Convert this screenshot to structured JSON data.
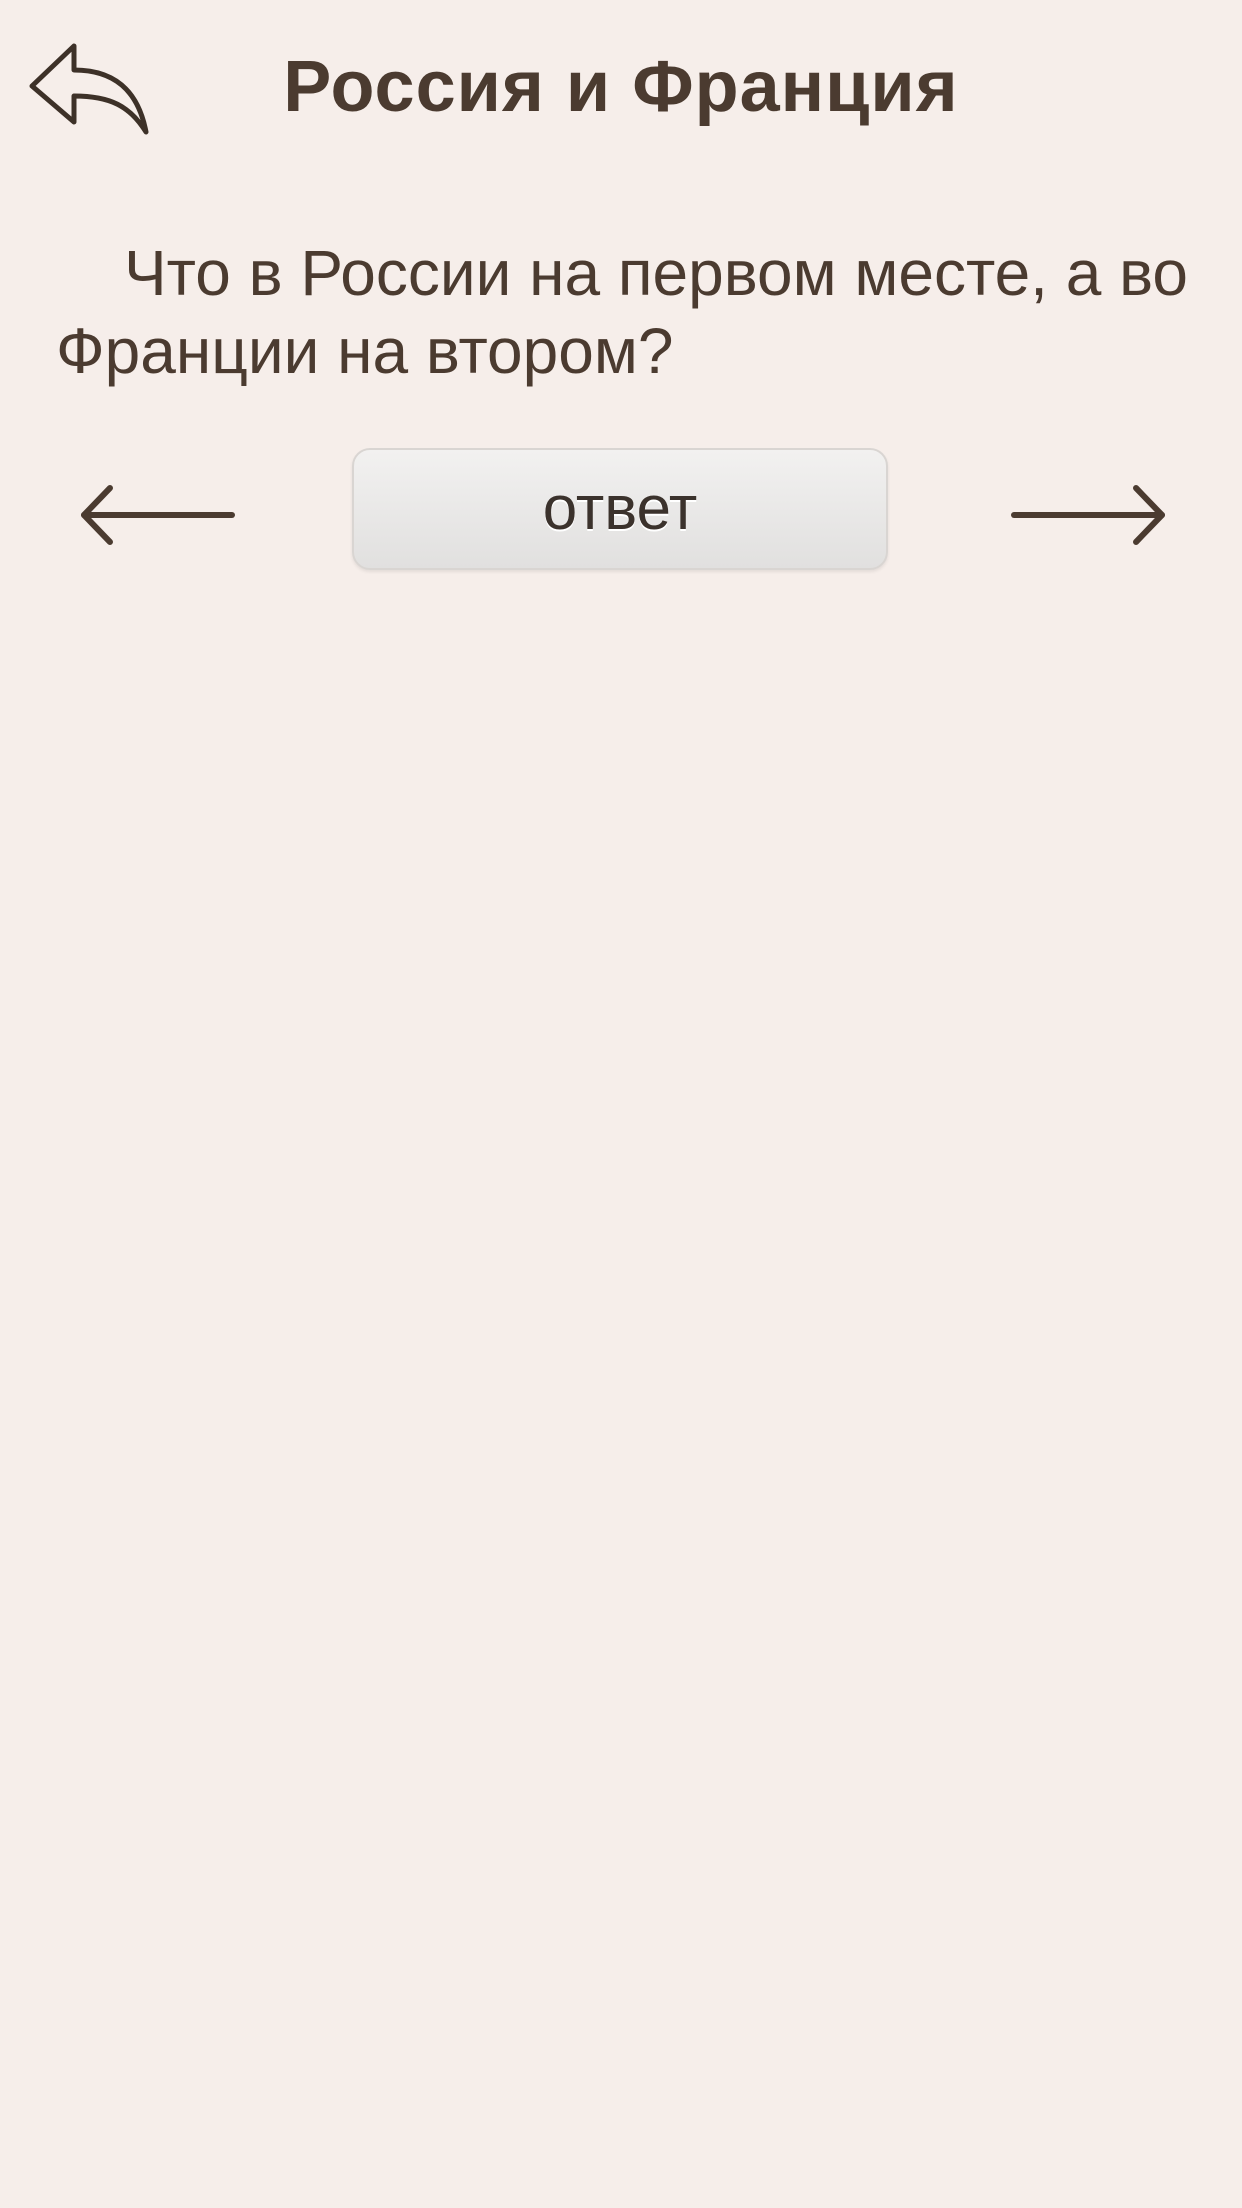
{
  "header": {
    "title": "Россия и Франция",
    "back_icon": "reply-back-icon"
  },
  "question": {
    "text": "Что в России на первом месте, а во Франции на втором?"
  },
  "navigation": {
    "prev_icon": "arrow-left-icon",
    "next_icon": "arrow-right-icon",
    "answer_label": "ответ"
  },
  "colors": {
    "background": "#f6eeea",
    "text": "#4b3b30",
    "button_bg": "#e8e7e6"
  }
}
